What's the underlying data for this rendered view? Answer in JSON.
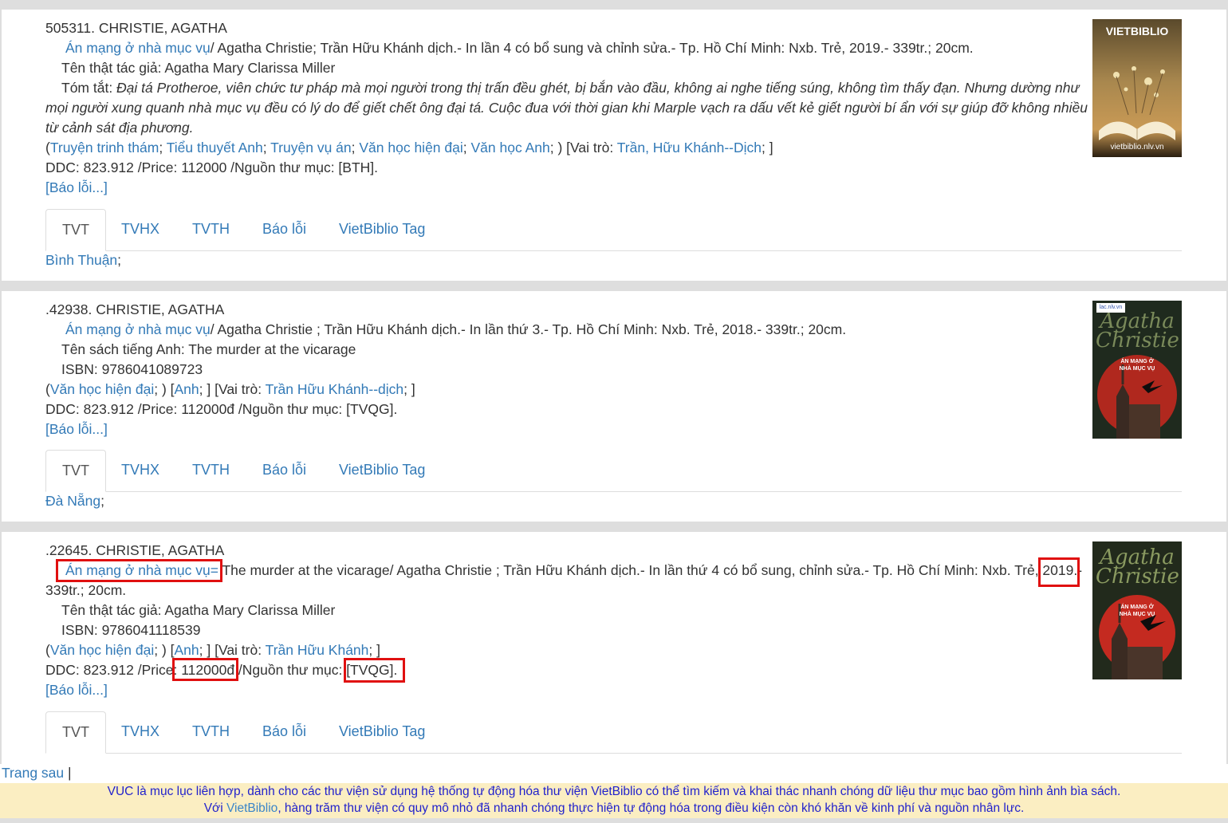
{
  "records": [
    {
      "heading": "505311. CHRISTIE, AGATHA",
      "title_link": "Án mạng ở nhà mục vụ",
      "title_rest": "/ Agatha Christie; Trần Hữu Khánh dịch.- In lần 4 có bổ sung và chỉnh sửa.- Tp. Hồ Chí Minh: Nxb. Trẻ, 2019.- 339tr.; 20cm.",
      "author_real": "Tên thật tác giả: Agatha Mary Clarissa Miller",
      "summary_label": "Tóm tắt: ",
      "summary": "Đại tá Protheroe, viên chức tư pháp mà mọi người trong thị trấn đều ghét, bị bắn vào đầu, không ai nghe tiếng súng, không tìm thấy đạn. Nhưng dường như mọi người xung quanh nhà mục vụ đều có lý do để giết chết ông đại tá. Cuộc đua với thời gian khi Marple vạch ra dấu vết kẻ giết người bí ẩn với sự giúp đỡ không nhiều từ cảnh sát địa phương.",
      "subjects": [
        "Truyện trinh thám",
        "Tiểu thuyết Anh",
        "Truyện vụ án",
        "Văn học hiện đại",
        "Văn học Anh"
      ],
      "role_label": "[Vai trò: ",
      "role_link": "Trần, Hữu Khánh--Dịch",
      "ddc": "DDC: 823.912 /Price: 112000 /Nguồn thư mục: [BTH].",
      "report": "[Báo lỗi...]",
      "library": "Bình Thuận",
      "cover_brand": "VIETBIBLIO",
      "cover_url": "vietbiblio.nlv.vn"
    },
    {
      "heading": ".42938. CHRISTIE, AGATHA",
      "title_link": "Án mạng ở nhà mục vụ",
      "title_rest": "/ Agatha Christie ; Trần Hữu Khánh dịch.- In lần thứ 3.- Tp. Hồ Chí Minh: Nxb. Trẻ, 2018.- 339tr.; 20cm.",
      "english_title": "Tên sách tiếng Anh: The murder at the vicarage",
      "isbn": "ISBN: 9786041089723",
      "subject": "Văn học hiện đại",
      "lang": "Anh",
      "role_label": "[Vai trò: ",
      "role_link": "Trần Hữu Khánh--dịch",
      "ddc": "DDC: 823.912 /Price: 112000đ /Nguồn thư mục: [TVQG].",
      "report": "[Báo lỗi...]",
      "library": "Đà Nẵng",
      "cover_tag": "lac.nlv.vn",
      "cover_author": "Agatha Christie",
      "cover_title": "ÁN MẠNG Ở NHÀ MỤC VỤ"
    },
    {
      "heading": ".22645. CHRISTIE, AGATHA",
      "title_link": "Án mạng ở nhà mục vụ=",
      "title_rest_a": " The murder at the vicarage/ Agatha Christie ; Trần Hữu Khánh dịch.- In lần thứ 4 có bổ sung, chỉnh sửa.- Tp. Hồ Chí Minh: Nxb. Trẻ, ",
      "year": "2019",
      "title_rest_b": ".-",
      "title_line2": "339tr.; 20cm.",
      "author_real": "Tên thật tác giả: Agatha Mary Clarissa Miller",
      "isbn": "ISBN: 9786041118539",
      "subject": "Văn học hiện đại",
      "lang": "Anh",
      "role_label": "[Vai trò: ",
      "role_link": "Trần Hữu Khánh",
      "ddc_a": "DDC: 823.912 /Price: ",
      "price": "112000đ",
      "ddc_b": " /Nguồn thư mục: ",
      "source": "[TVQG].",
      "report": "[Báo lỗi...]",
      "cover_author": "Agatha Christie",
      "cover_title": "ÁN MẠNG Ở NHÀ MỤC VỤ"
    }
  ],
  "tabs": [
    "TVT",
    "TVHX",
    "TVTH",
    "Báo lỗi",
    "VietBiblio Tag"
  ],
  "next_page": "Trang sau",
  "footer": {
    "line1": "VUC là mục lục liên hợp, dành cho các thư viện sử dụng hệ thống tự động hóa thư viện VietBiblio có thể tìm kiếm và khai thác nhanh chóng dữ liệu thư mục bao gồm hình ảnh bìa sách.",
    "line2_a": "Với ",
    "line2_link": "VietBiblio",
    "line2_b": ", hàng trăm thư viện có quy mô nhỏ đã nhanh chóng thực hiện tự động hóa trong điều kiện còn khó khăn về kinh phí và nguồn nhân lực."
  },
  "colors": {
    "link": "#337ab7",
    "highlight": "#e01010",
    "footer_bg": "#fbeec2",
    "footer_text": "#2222cc"
  }
}
